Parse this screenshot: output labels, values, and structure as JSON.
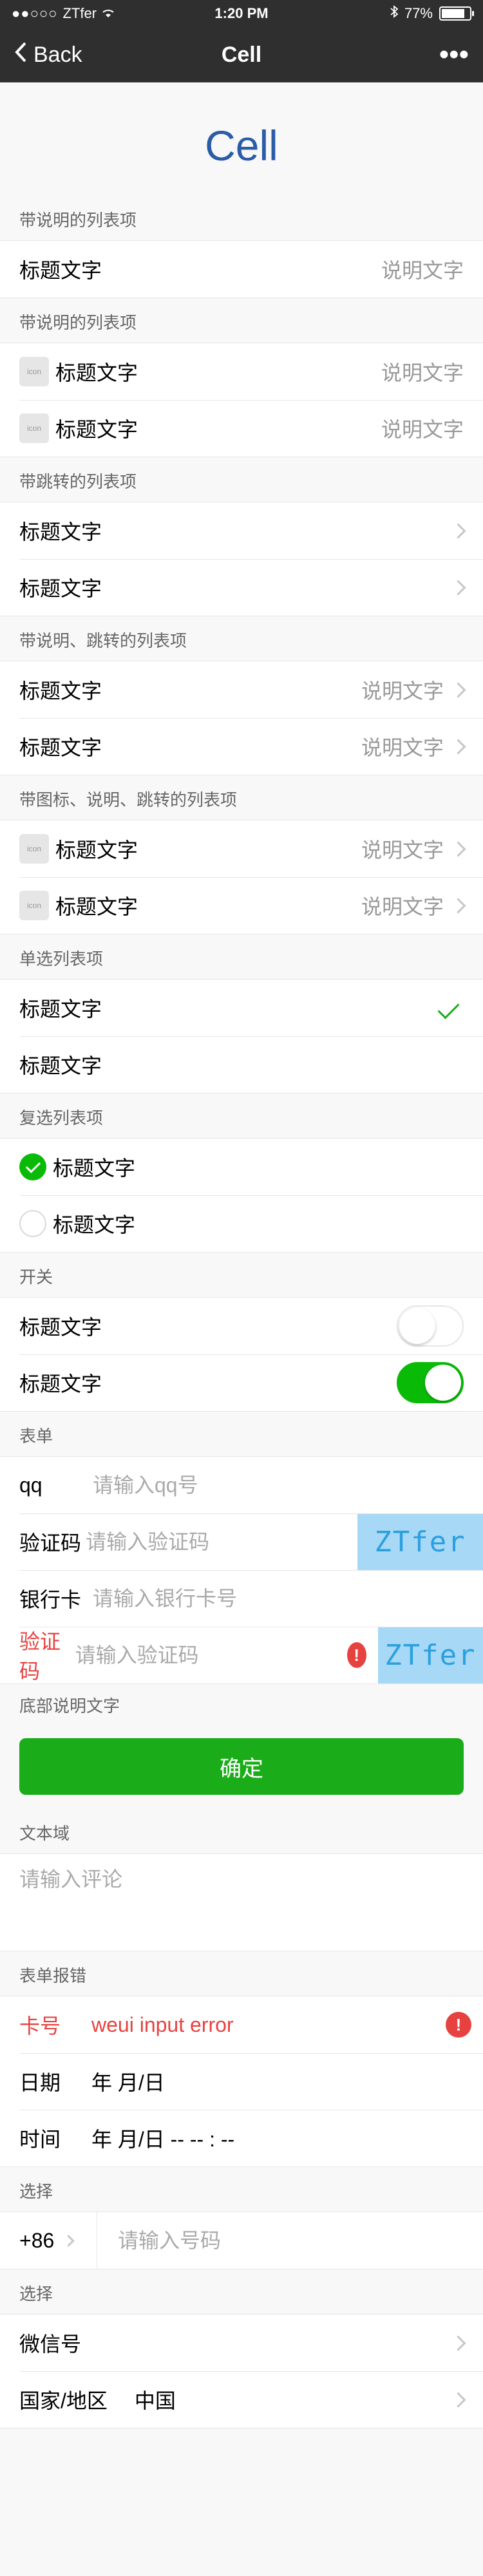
{
  "status_bar": {
    "carrier_dots": "●●○○○",
    "carrier": "ZTfer",
    "time": "1:20 PM",
    "battery": "77%",
    "battery_level": 0.77
  },
  "navbar": {
    "back_label": "Back",
    "title": "Cell",
    "more_label": "•••"
  },
  "page_title": "Cell",
  "sections": {
    "desc_list": {
      "title": "带说明的列表项",
      "cell": {
        "title": "标题文字",
        "desc": "说明文字"
      }
    },
    "icon_desc_list": {
      "title": "带说明的列表项",
      "icon_text": "icon",
      "cells": [
        {
          "title": "标题文字",
          "desc": "说明文字"
        },
        {
          "title": "标题文字",
          "desc": "说明文字"
        }
      ]
    },
    "jump_list": {
      "title": "带跳转的列表项",
      "cells": [
        {
          "title": "标题文字"
        },
        {
          "title": "标题文字"
        }
      ]
    },
    "desc_jump_list": {
      "title": "带说明、跳转的列表项",
      "cells": [
        {
          "title": "标题文字",
          "desc": "说明文字"
        },
        {
          "title": "标题文字",
          "desc": "说明文字"
        }
      ]
    },
    "icon_desc_jump_list": {
      "title": "带图标、说明、跳转的列表项",
      "icon_text": "icon",
      "cells": [
        {
          "title": "标题文字",
          "desc": "说明文字"
        },
        {
          "title": "标题文字",
          "desc": "说明文字"
        }
      ]
    },
    "radio_list": {
      "title": "单选列表项",
      "cells": [
        {
          "title": "标题文字",
          "checked": true
        },
        {
          "title": "标题文字",
          "checked": false
        }
      ]
    },
    "checkbox_list": {
      "title": "复选列表项",
      "cells": [
        {
          "title": "标题文字",
          "checked": true
        },
        {
          "title": "标题文字",
          "checked": false
        }
      ]
    },
    "switch_list": {
      "title": "开关",
      "cells": [
        {
          "title": "标题文字",
          "on": false
        },
        {
          "title": "标题文字",
          "on": true
        }
      ]
    },
    "form": {
      "title": "表单",
      "rows": [
        {
          "label": "qq",
          "placeholder": "请输入qq号"
        },
        {
          "label": "验证码",
          "placeholder": "请输入验证码",
          "vcode": "ZTfer"
        },
        {
          "label": "银行卡",
          "placeholder": "请输入银行卡号"
        },
        {
          "label": "验证码",
          "placeholder": "请输入验证码",
          "vcode": "ZTfer",
          "error_icon": "!"
        }
      ],
      "footer_tip": "底部说明文字",
      "confirm_label": "确定"
    },
    "textarea": {
      "title": "文本域",
      "placeholder": "请输入评论"
    },
    "form_error": {
      "title": "表单报错",
      "card_label": "卡号",
      "card_value": "weui input error",
      "error_icon": "!",
      "date_label": "日期",
      "date_value": "年  月/日",
      "time_label": "时间",
      "time_value": "年  月/日  -- -- : --"
    },
    "select_phone": {
      "title": "选择",
      "code": "+86",
      "placeholder": "请输入号码"
    },
    "select_list": {
      "title": "选择",
      "cells": [
        {
          "title": "微信号",
          "value": ""
        },
        {
          "title": "国家/地区",
          "value": "中国"
        }
      ]
    }
  }
}
